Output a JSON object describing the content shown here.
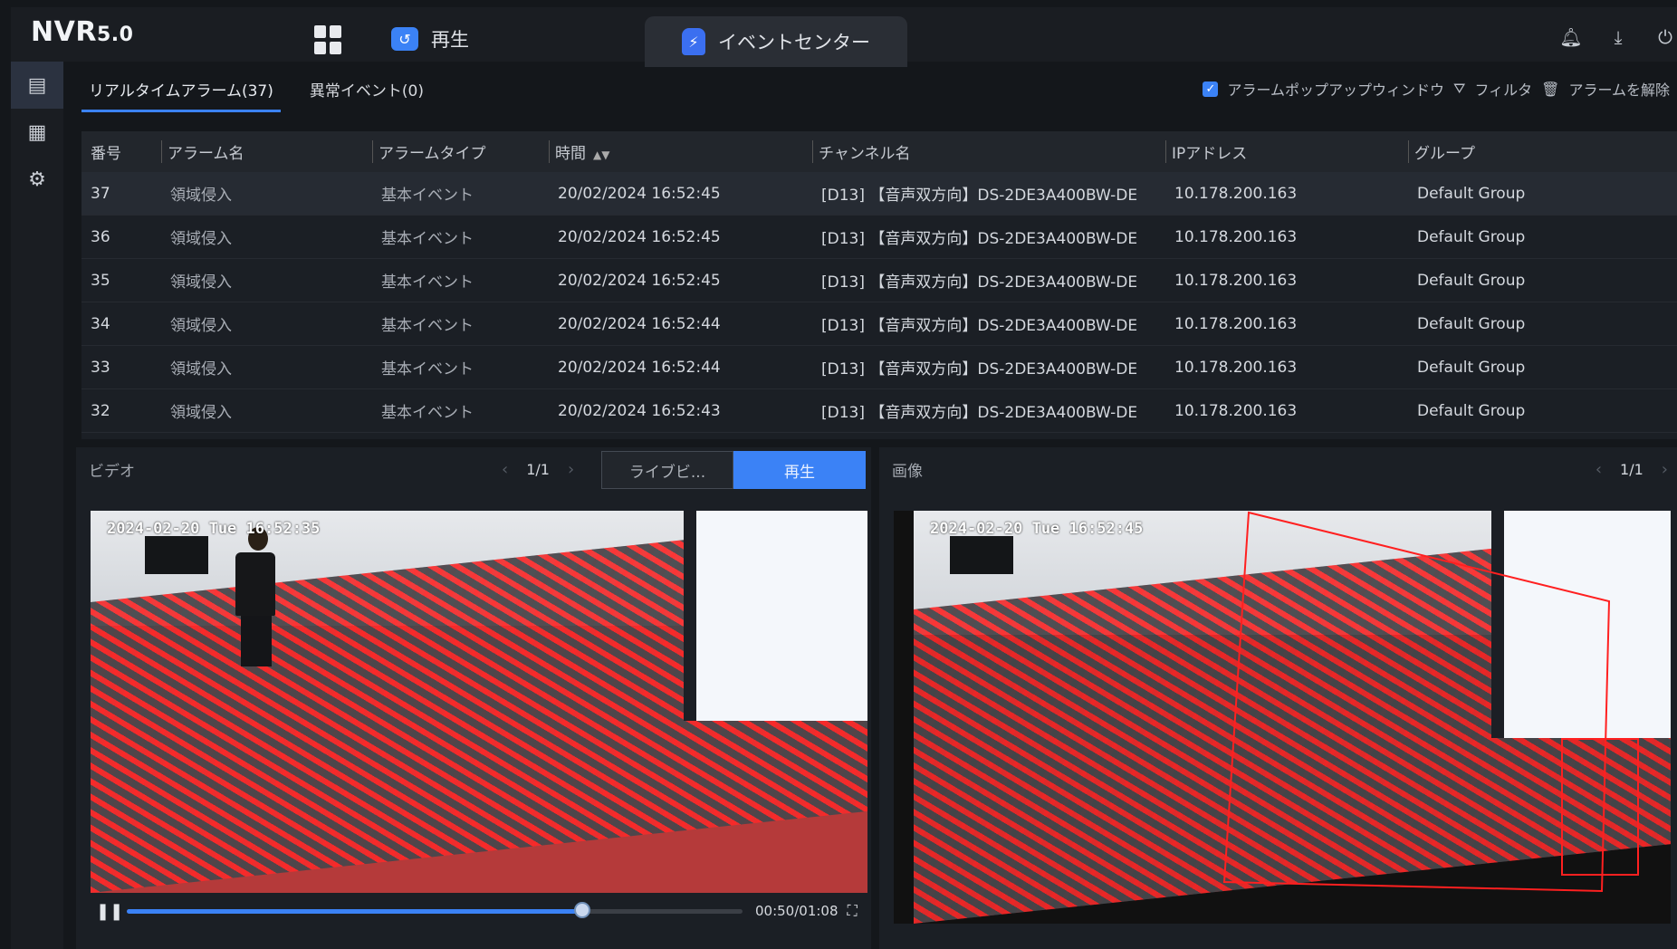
{
  "app": {
    "logo_main": "NVR",
    "logo_ver": "5.0"
  },
  "topnav": {
    "play_label": "再生",
    "event_center_label": "イベントセンター"
  },
  "subtabs": [
    {
      "label": "リアルタイムアラーム(37)",
      "active": true
    },
    {
      "label": "異常イベント(0)",
      "active": false
    }
  ],
  "toolbar": {
    "popup_label": "アラームポップアップウィンドウ",
    "popup_checked": true,
    "filter_label": "フィルタ",
    "clear_label": "アラームを解除"
  },
  "table": {
    "headers": [
      "番号",
      "アラーム名",
      "アラームタイプ",
      "時間",
      "チャンネル名",
      "IPアドレス",
      "グループ"
    ],
    "rows": [
      [
        "37",
        "領域侵入",
        "基本イベント",
        "20/02/2024 16:52:45",
        "[D13] 【音声双方向】DS-2DE3A400BW-DE",
        "10.178.200.163",
        "Default Group"
      ],
      [
        "36",
        "領域侵入",
        "基本イベント",
        "20/02/2024 16:52:45",
        "[D13] 【音声双方向】DS-2DE3A400BW-DE",
        "10.178.200.163",
        "Default Group"
      ],
      [
        "35",
        "領域侵入",
        "基本イベント",
        "20/02/2024 16:52:45",
        "[D13] 【音声双方向】DS-2DE3A400BW-DE",
        "10.178.200.163",
        "Default Group"
      ],
      [
        "34",
        "領域侵入",
        "基本イベント",
        "20/02/2024 16:52:44",
        "[D13] 【音声双方向】DS-2DE3A400BW-DE",
        "10.178.200.163",
        "Default Group"
      ],
      [
        "33",
        "領域侵入",
        "基本イベント",
        "20/02/2024 16:52:44",
        "[D13] 【音声双方向】DS-2DE3A400BW-DE",
        "10.178.200.163",
        "Default Group"
      ],
      [
        "32",
        "領域侵入",
        "基本イベント",
        "20/02/2024 16:52:43",
        "[D13] 【音声双方向】DS-2DE3A400BW-DE",
        "10.178.200.163",
        "Default Group"
      ]
    ]
  },
  "video_panel": {
    "title": "ビデオ",
    "page": "1/1",
    "live_label": "ライブビ...",
    "playback_label": "再生",
    "osd": "2024-02-20 Tue 16:52:35",
    "timecode": "00:50/01:08",
    "progress": 0.74
  },
  "image_panel": {
    "title": "画像",
    "page": "1/1",
    "osd": "2024-02-20 Tue 16:52:45"
  },
  "colors": {
    "accent": "#3b82f6",
    "zone": "#ff2020"
  }
}
